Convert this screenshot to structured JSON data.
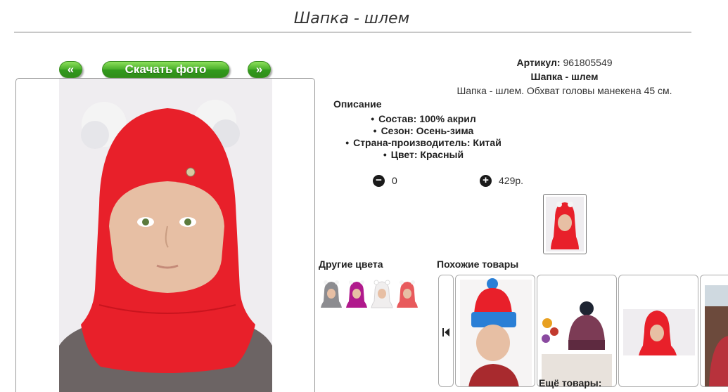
{
  "page": {
    "title": "Шапка - шлем"
  },
  "gallery": {
    "prev_label": "«",
    "download_label": "Скачать фото",
    "next_label": "»"
  },
  "product": {
    "article_label": "Артикул:",
    "article_value": "961805549",
    "name": "Шапка - шлем",
    "description": "Шапка - шлем. Обхват головы манекена 45 см.",
    "description_heading": "Описание",
    "properties": [
      "Состав: 100% акрил",
      "Сезон: Осень-зима",
      "Страна-производитель: Китай",
      "Цвет: Красный"
    ],
    "quantity": "0",
    "price": "429р."
  },
  "sections": {
    "other_colors": "Другие цвета",
    "similar": "Похожие товары",
    "more": "Ещё товары:"
  },
  "colors": {
    "accent_green": "#4ab02b",
    "hat_red": "#e8202a",
    "other_colors": [
      "#8c8c90",
      "#b0198c",
      "#f0eeee",
      "#e85a5c"
    ]
  },
  "icons": {
    "minus": "minus-circle-icon",
    "plus": "plus-circle-icon",
    "carousel_prev": "skip-back-icon"
  }
}
